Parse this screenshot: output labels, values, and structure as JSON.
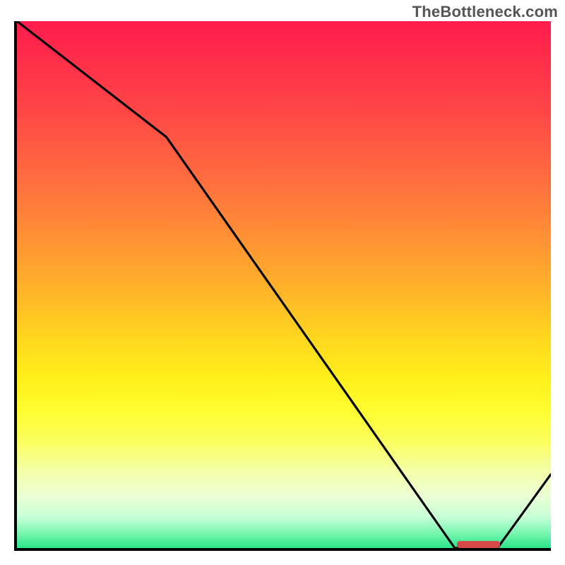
{
  "attribution": "TheBottleneck.com",
  "chart_data": {
    "type": "line",
    "title": "",
    "xlabel": "",
    "ylabel": "",
    "xlim": [
      0,
      100
    ],
    "ylim": [
      0,
      100
    ],
    "x": [
      0,
      28,
      82,
      90,
      100
    ],
    "values": [
      100,
      78,
      0,
      0,
      14
    ],
    "annotations": [
      {
        "kind": "highlight-bar",
        "x_start": 82,
        "x_end": 90,
        "y": 0
      }
    ]
  }
}
